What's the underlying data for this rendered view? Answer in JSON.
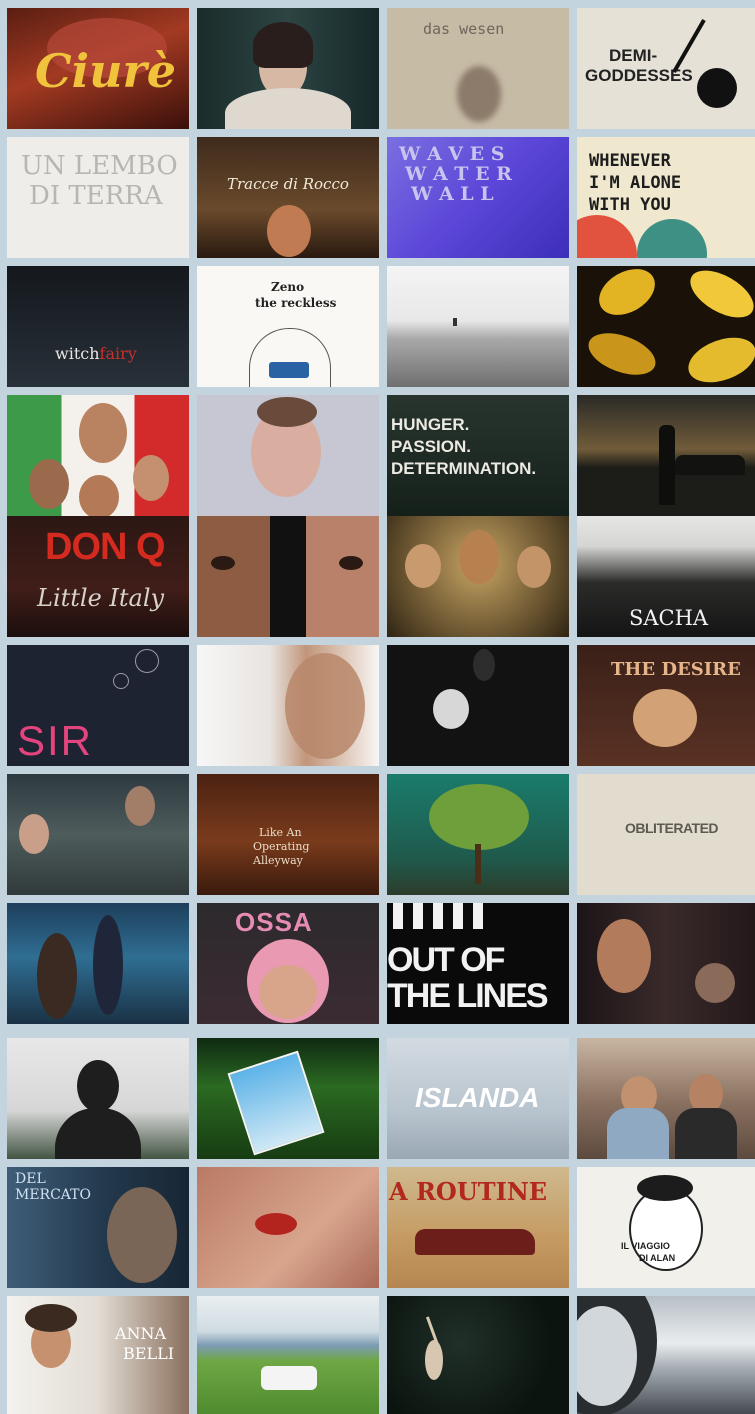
{
  "posters": [
    {
      "id": "ciure",
      "lines": [
        "Ciurè"
      ]
    },
    {
      "id": "veil",
      "lines": []
    },
    {
      "id": "das-wesen",
      "lines": [
        "das wesen"
      ]
    },
    {
      "id": "demi-goddesses",
      "lines": [
        "DEMI-",
        "GODDESSES"
      ]
    },
    {
      "id": "un-lembo",
      "lines": [
        "UN LEMBO",
        "DI TERRA"
      ]
    },
    {
      "id": "tracce",
      "lines": [
        "Tracce di Rocco"
      ]
    },
    {
      "id": "waves",
      "lines": [
        "W A V E S",
        "W A T E R",
        "W A L L"
      ]
    },
    {
      "id": "whenever",
      "lines": [
        "WHENEVER",
        "I'M ALONE",
        "WITH YOU"
      ]
    },
    {
      "id": "witchfairy",
      "lines": [
        "witch",
        "fairy"
      ]
    },
    {
      "id": "zeno",
      "lines": [
        "Zeno",
        "the reckless"
      ]
    },
    {
      "id": "white-field",
      "lines": []
    },
    {
      "id": "gold-splash",
      "lines": []
    },
    {
      "id": "italian-family",
      "lines": []
    },
    {
      "id": "hands-face",
      "lines": []
    },
    {
      "id": "hunger",
      "lines": [
        "HUNGER.",
        "PASSION.",
        "DETERMINATION."
      ]
    },
    {
      "id": "night-road",
      "lines": []
    },
    {
      "id": "don-q",
      "lines": [
        "DON Q",
        "Little Italy"
      ]
    },
    {
      "id": "two-faces",
      "lines": []
    },
    {
      "id": "three-men",
      "lines": []
    },
    {
      "id": "sacha",
      "lines": [
        "SACHA"
      ]
    },
    {
      "id": "sir",
      "lines": [
        "SIR"
      ]
    },
    {
      "id": "profile",
      "lines": []
    },
    {
      "id": "doll",
      "lines": []
    },
    {
      "id": "the-desire",
      "lines": [
        "THE DESIRE"
      ]
    },
    {
      "id": "family-porch",
      "lines": []
    },
    {
      "id": "alleyway",
      "lines": [
        "Like An",
        "Operating",
        "Alleyway"
      ]
    },
    {
      "id": "tree",
      "lines": []
    },
    {
      "id": "obliterated",
      "lines": [
        "OBLITERATED"
      ]
    },
    {
      "id": "sea-couple",
      "lines": []
    },
    {
      "id": "ossa",
      "lines": [
        "OSSA"
      ]
    },
    {
      "id": "out-of-lines",
      "lines": [
        "OUT OF",
        "THE LINES"
      ]
    },
    {
      "id": "portrait-woman",
      "lines": []
    },
    {
      "id": "bust",
      "lines": []
    },
    {
      "id": "sky-card",
      "lines": []
    },
    {
      "id": "islanda",
      "lines": [
        "ISLANDA"
      ]
    },
    {
      "id": "two-men",
      "lines": []
    },
    {
      "id": "del-mercato",
      "lines": [
        "DEL",
        "MERCATO"
      ]
    },
    {
      "id": "lips",
      "lines": []
    },
    {
      "id": "a-routine",
      "lines": [
        "A ROUTINE"
      ]
    },
    {
      "id": "il-viaggio",
      "lines": [
        "IL VIAGGIO",
        "DI ALAN"
      ]
    },
    {
      "id": "bride",
      "lines": [
        "ANNA",
        "BELLI"
      ]
    },
    {
      "id": "camper",
      "lines": []
    },
    {
      "id": "dancer",
      "lines": []
    },
    {
      "id": "wave",
      "lines": []
    }
  ]
}
